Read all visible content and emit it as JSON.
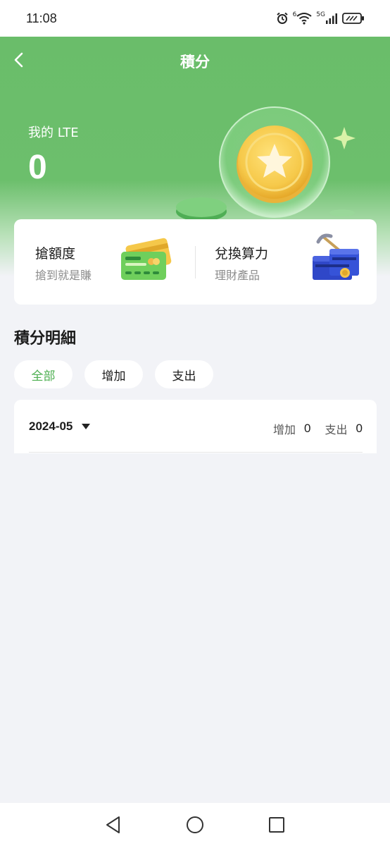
{
  "status_bar": {
    "time": "11:08",
    "signal_label_1": "6",
    "signal_label_2": "5G"
  },
  "header": {
    "title": "積分",
    "back_icon": "chevron-left-icon"
  },
  "points": {
    "label": "我的 LTE",
    "value": "0"
  },
  "actions": [
    {
      "title": "搶額度",
      "subtitle": "搶到就是賺",
      "icon": "credit-card-icon"
    },
    {
      "title": "兌換算力",
      "subtitle": "理財產品",
      "icon": "mining-machine-icon"
    }
  ],
  "details": {
    "title": "積分明細",
    "filters": [
      {
        "label": "全部",
        "active": true
      },
      {
        "label": "增加",
        "active": false
      },
      {
        "label": "支出",
        "active": false
      }
    ],
    "month": "2024-05",
    "increase_label": "增加",
    "increase_value": "0",
    "expense_label": "支出",
    "expense_value": "0"
  },
  "colors": {
    "brand_green": "#6abd6a",
    "active_chip": "#4caf50",
    "background": "#f2f3f7"
  },
  "system_nav": {
    "back": "triangle-back-icon",
    "home": "circle-home-icon",
    "recents": "square-recents-icon"
  }
}
